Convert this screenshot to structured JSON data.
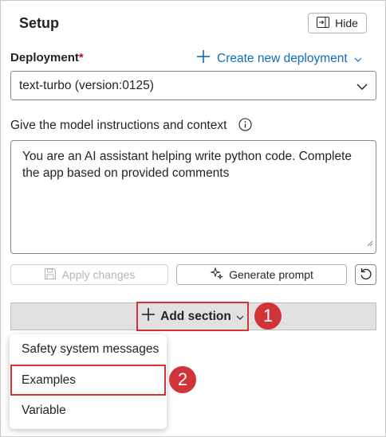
{
  "panel": {
    "title": "Setup",
    "hide_label": "Hide"
  },
  "deployment": {
    "label": "Deployment",
    "required_mark": "*",
    "create_link": "Create new deployment",
    "selected": "text-turbo (version:0125)"
  },
  "instructions": {
    "label": "Give the model instructions and context",
    "value": "You are an AI assistant helping write python code. Complete the app based on provided comments"
  },
  "actions": {
    "apply_label": "Apply changes",
    "generate_label": "Generate prompt"
  },
  "add_section": {
    "label": "Add section"
  },
  "menu": {
    "items": [
      "Safety system messages",
      "Examples",
      "Variable"
    ]
  },
  "callouts": {
    "one": "1",
    "two": "2"
  },
  "colors": {
    "accent": "#0f6cbd",
    "callout": "#d13438",
    "required": "#c50f1f"
  }
}
